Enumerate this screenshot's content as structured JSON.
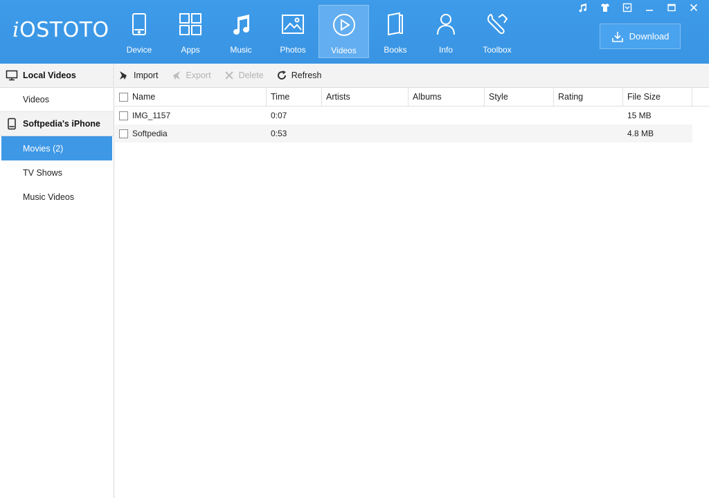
{
  "app": {
    "logo_prefix": "i",
    "logo_rest": "OSTOTO"
  },
  "nav": [
    {
      "label": "Device",
      "icon": "device-icon",
      "active": false
    },
    {
      "label": "Apps",
      "icon": "apps-icon",
      "active": false
    },
    {
      "label": "Music",
      "icon": "music-icon",
      "active": false
    },
    {
      "label": "Photos",
      "icon": "photos-icon",
      "active": false
    },
    {
      "label": "Videos",
      "icon": "videos-icon",
      "active": true
    },
    {
      "label": "Books",
      "icon": "books-icon",
      "active": false
    },
    {
      "label": "Info",
      "icon": "info-icon",
      "active": false
    },
    {
      "label": "Toolbox",
      "icon": "toolbox-icon",
      "active": false
    }
  ],
  "window_controls": [
    "music-note-icon",
    "shirt-icon",
    "menu-dropdown-icon",
    "minimize-icon",
    "maximize-icon",
    "close-icon"
  ],
  "download": {
    "label": "Download",
    "icon": "download-icon"
  },
  "sidebar": {
    "local_header": {
      "label": "Local Videos",
      "icon": "monitor-icon"
    },
    "local_items": [
      {
        "label": "Videos"
      }
    ],
    "device_header": {
      "label": "Softpedia's iPhone",
      "icon": "phone-icon"
    },
    "device_items": [
      {
        "label": "Movies (2)",
        "active": true
      },
      {
        "label": "TV Shows",
        "active": false
      },
      {
        "label": "Music Videos",
        "active": false
      }
    ]
  },
  "toolbar": {
    "import": {
      "label": "Import",
      "enabled": true
    },
    "export": {
      "label": "Export",
      "enabled": false
    },
    "delete": {
      "label": "Delete",
      "enabled": false
    },
    "refresh": {
      "label": "Refresh",
      "enabled": true
    }
  },
  "table": {
    "columns": [
      "Name",
      "Time",
      "Artists",
      "Albums",
      "Style",
      "Rating",
      "File Size"
    ],
    "rows": [
      {
        "name": "IMG_1157",
        "time": "0:07",
        "artists": "",
        "albums": "",
        "style": "",
        "rating": "",
        "size": "15 MB"
      },
      {
        "name": "Softpedia",
        "time": "0:53",
        "artists": "",
        "albums": "",
        "style": "",
        "rating": "",
        "size": "4.8 MB"
      }
    ]
  },
  "colors": {
    "header_bg": "#3a97e5",
    "accent": "#3e98e6",
    "active_tab": "#62aef0"
  }
}
